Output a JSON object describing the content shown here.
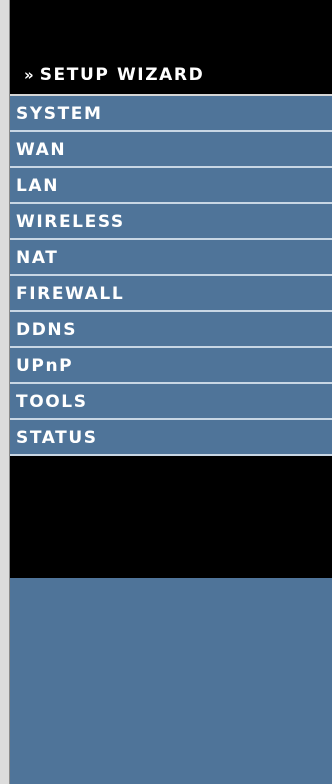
{
  "nav": {
    "active": {
      "label": "SETUP WIZARD",
      "arrow": "»"
    },
    "items": [
      {
        "label": "SYSTEM"
      },
      {
        "label": "WAN"
      },
      {
        "label": "LAN"
      },
      {
        "label": "WIRELESS"
      },
      {
        "label": "NAT"
      },
      {
        "label": "FIREWALL"
      },
      {
        "label": "DDNS"
      },
      {
        "label": "UPnP"
      },
      {
        "label": "TOOLS"
      },
      {
        "label": "STATUS"
      }
    ]
  },
  "colors": {
    "nav_background": "#4f7499",
    "active_background": "#000000",
    "text": "#ffffff",
    "divider": "#c8d6e4"
  }
}
